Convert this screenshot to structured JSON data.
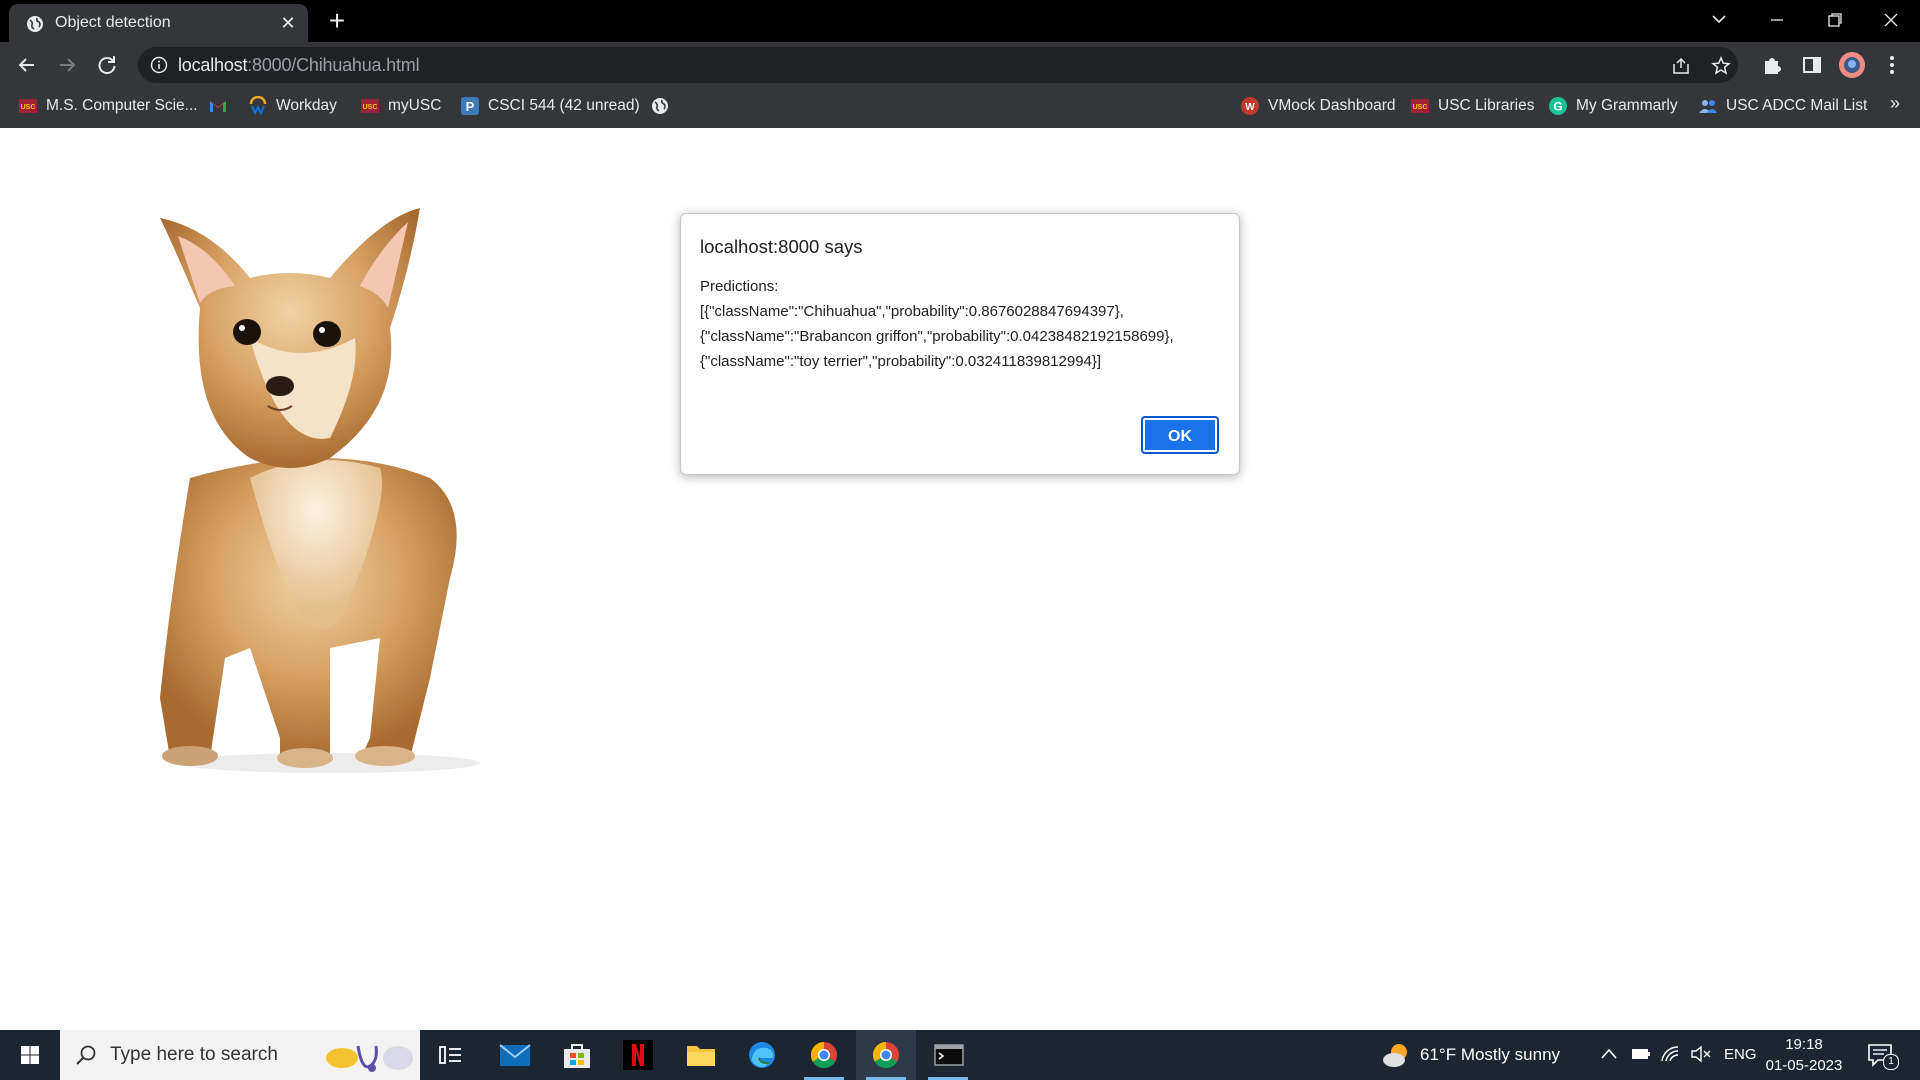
{
  "browser": {
    "tab_title": "Object detection",
    "url_host": "localhost",
    "url_path": ":8000/Chihuahua.html"
  },
  "bookmarks": [
    {
      "label": "M.S. Computer Scie...",
      "icon": "usc-icon"
    },
    {
      "label": "",
      "icon": "gmail-icon"
    },
    {
      "label": "Workday",
      "icon": "workday-icon"
    },
    {
      "label": "myUSC",
      "icon": "usc-icon"
    },
    {
      "label": "CSCI 544 (42 unread)",
      "icon": "piazza-icon"
    },
    {
      "label": "",
      "icon": "globe-icon"
    },
    {
      "label": "VMock Dashboard",
      "icon": "vmock-icon"
    },
    {
      "label": "USC Libraries",
      "icon": "usc-icon"
    },
    {
      "label": "My Grammarly",
      "icon": "grammarly-icon"
    },
    {
      "label": "USC ADCC Mail List",
      "icon": "group-icon"
    }
  ],
  "dialog": {
    "title": "localhost:8000 says",
    "message": "Predictions:\n[{\"className\":\"Chihuahua\",\"probability\":0.8676028847694397},\n{\"className\":\"Brabancon griffon\",\"probability\":0.04238482192158699},\n{\"className\":\"toy terrier\",\"probability\":0.032411839812994}]",
    "ok_label": "OK"
  },
  "taskbar": {
    "search_placeholder": "Type here to search",
    "weather": "61°F  Mostly sunny",
    "language": "ENG",
    "time": "19:18",
    "date": "01-05-2023",
    "notification_count": "1"
  },
  "colors": {
    "chrome_dark": "#35363a",
    "titlebar": "#000000",
    "ok_button": "#1a73e8",
    "taskbar": "#1c2633"
  }
}
